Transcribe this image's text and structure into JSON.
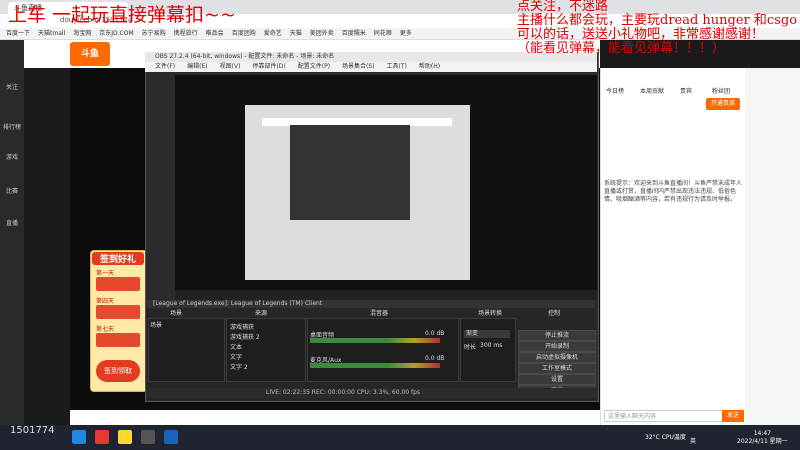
{
  "browser": {
    "tab_title": "斗鱼直播",
    "url": "douyu.com/1501774",
    "bookmarks": [
      "百度一下",
      "天猫tmall",
      "淘宝网",
      "京东JD.COM",
      "苏宁易购",
      "携程旅行",
      "唯品会",
      "百度团购",
      "爱奇艺",
      "天猫",
      "美团外卖",
      "百度糯米",
      "同花顺",
      "更多"
    ]
  },
  "overlay": {
    "left_text": "上车  一起玩直接弹幕扣~~",
    "right_lines": [
      "点关注，不迷路",
      "主播什么都会玩，主要玩dread hunger 和csgo",
      "可以的话，送送小礼物吧，非常感谢感谢！",
      "（能看见弹幕，能看见弹幕！！！）"
    ]
  },
  "douyu": {
    "logo": "斗鱼",
    "left_nav": [
      "关注",
      "排行榜",
      "游戏",
      "比赛",
      "直播"
    ],
    "right_tabs": [
      "今日榜",
      "本周贡献",
      "贵宾",
      "粉丝团"
    ],
    "gift_button": "开通贵族",
    "chat_welcome": "系统提示：欢迎来到斗鱼直播间！斗鱼严禁未成年人直播或打赏，直播间内严禁出现违法违规、低俗色情、吸烟酗酒等内容，若有违规行为请及时举报。",
    "chat_input_placeholder": "这里输入聊天内容",
    "send_label": "发送",
    "viewer_count": "1501774",
    "signin_title": "签到好礼",
    "signin_days": [
      "第一天",
      "第四天",
      "第七天"
    ],
    "signin_bottom": "签到领取"
  },
  "obs": {
    "title": "OBS 27.2.4 (64-bit, windows) - 配置文件: 未命名 - 场景: 未命名",
    "menu": [
      "文件(F)",
      "编辑(E)",
      "视图(V)",
      "停靠部件(D)",
      "配置文件(P)",
      "场景集合(S)",
      "工具(T)",
      "帮助(H)"
    ],
    "dock_headers": [
      "场景",
      "来源",
      "混音器",
      "场景转换",
      "控制"
    ],
    "scene_name": "场景",
    "sources": [
      "游戏捕获",
      "游戏捕获 2",
      "文本",
      "文字",
      "文字 2"
    ],
    "mixer": [
      {
        "name": "桌面音频",
        "db": "0.0 dB"
      },
      {
        "name": "麦克风/Aux",
        "db": "0.0 dB"
      }
    ],
    "transition": {
      "name": "渐变",
      "duration_label": "时长",
      "duration": "300 ms"
    },
    "controls": [
      "停止推流",
      "开始录制",
      "启动虚拟摄像机",
      "工作室模式",
      "设置",
      "退出"
    ],
    "status": "LIVE: 02:22:35   REC: 00:00:00   CPU: 3.3%, 60.00 fps",
    "window_capture": "[League of Legends.exe]: League of Legends (TM) Client"
  },
  "taskbar": {
    "cpu": "32°C CPU温度",
    "ime": "英",
    "time": "14:47",
    "date": "2022/4/11 星期一"
  }
}
